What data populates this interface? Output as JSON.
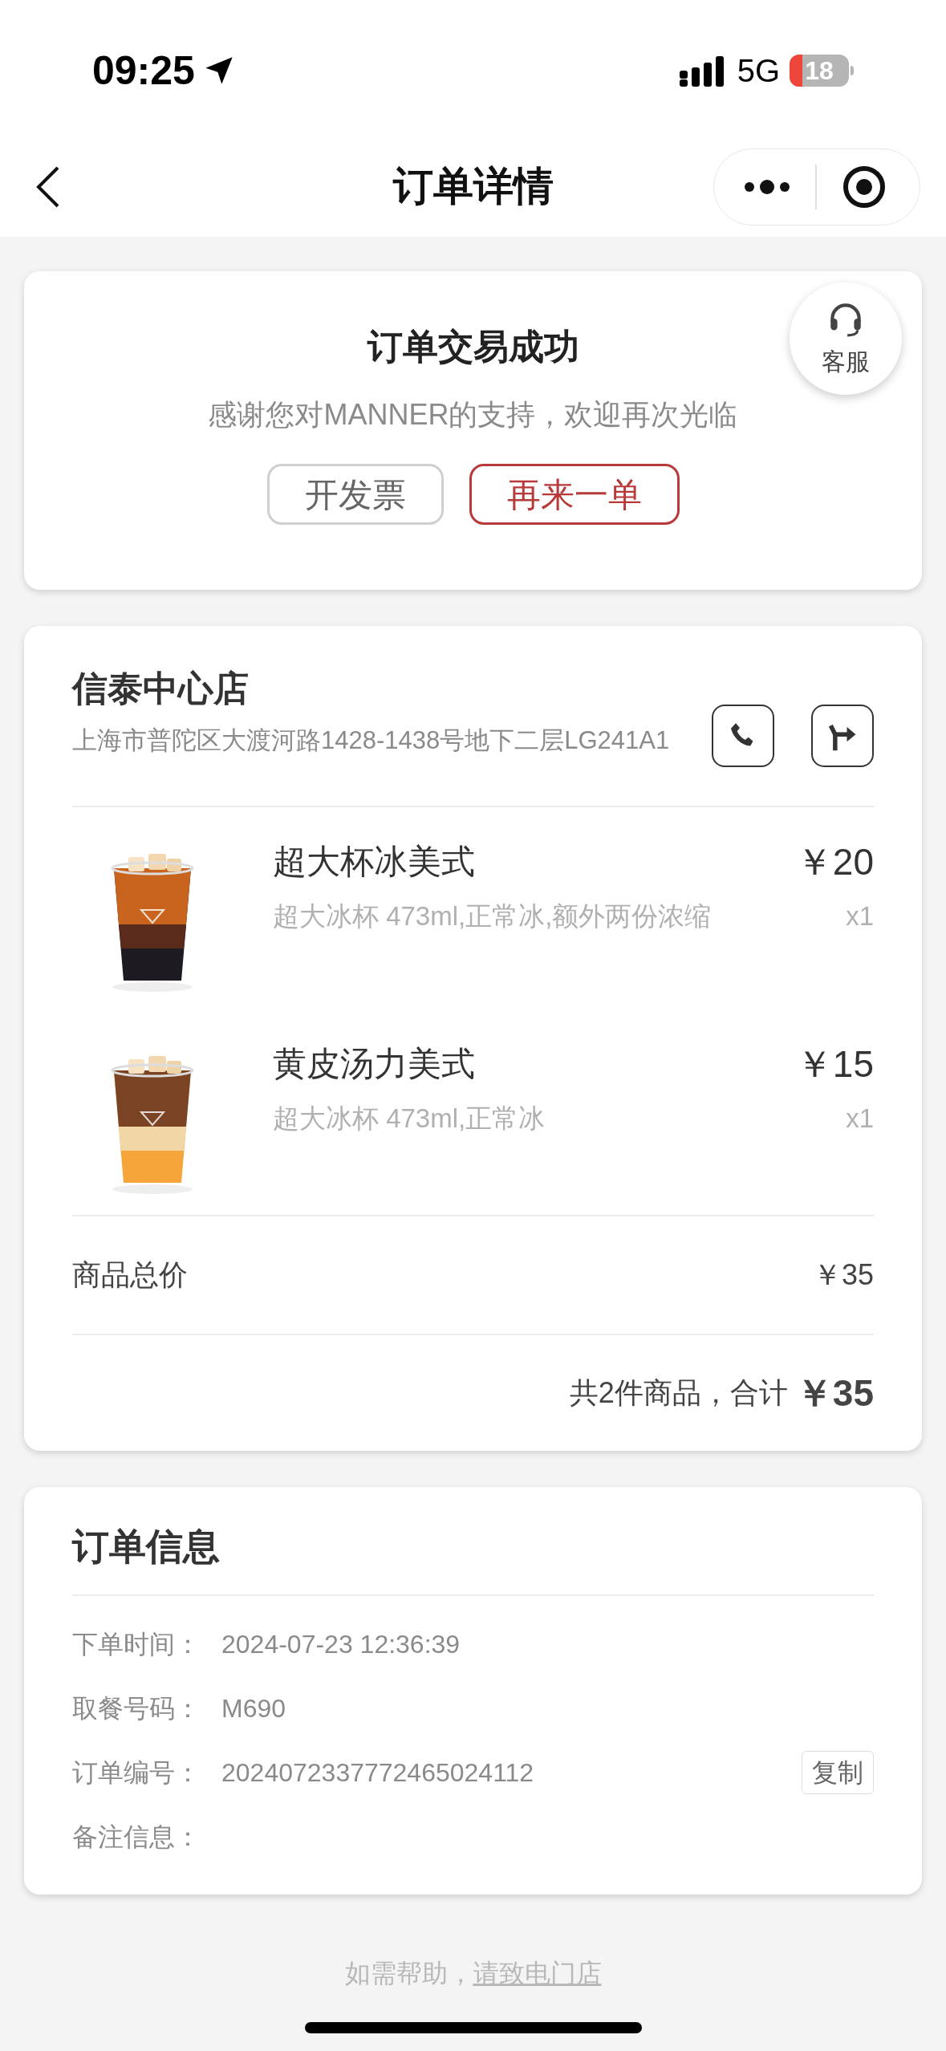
{
  "status_bar": {
    "time": "09:25",
    "network": "5G",
    "battery": "18"
  },
  "nav": {
    "title": "订单详情"
  },
  "status_card": {
    "title": "订单交易成功",
    "message": "感谢您对MANNER的支持，欢迎再次光临",
    "support": "客服",
    "buttons": [
      {
        "label": "开发票",
        "kind": "default"
      },
      {
        "label": "再来一单",
        "kind": "primary"
      }
    ]
  },
  "store": {
    "name": "信泰中心店",
    "address": "上海市普陀区大渡河路1428-1438号地下二层LG241A1"
  },
  "items": [
    {
      "name": "超大杯冰美式",
      "options": "超大冰杯 473ml,正常冰,额外两份浓缩",
      "price": "￥20",
      "quantity": "x1"
    },
    {
      "name": "黄皮汤力美式",
      "options": "超大冰杯 473ml,正常冰",
      "price": "￥15",
      "quantity": "x1"
    }
  ],
  "summary": {
    "subtotal_label": "商品总价",
    "subtotal": "￥35",
    "total_label": "共2件商品，合计",
    "total": "￥35"
  },
  "order_info": {
    "title": "订单信息",
    "fields": [
      {
        "label": "下单时间：",
        "value": "2024-07-23 12:36:39"
      },
      {
        "label": "取餐号码：",
        "value": "M690"
      },
      {
        "label": "订单编号：",
        "value": "2024072337772465024112",
        "action": "复制"
      },
      {
        "label": "备注信息："
      }
    ]
  },
  "footer": {
    "text": "如需帮助，",
    "link": "请致电门店"
  }
}
